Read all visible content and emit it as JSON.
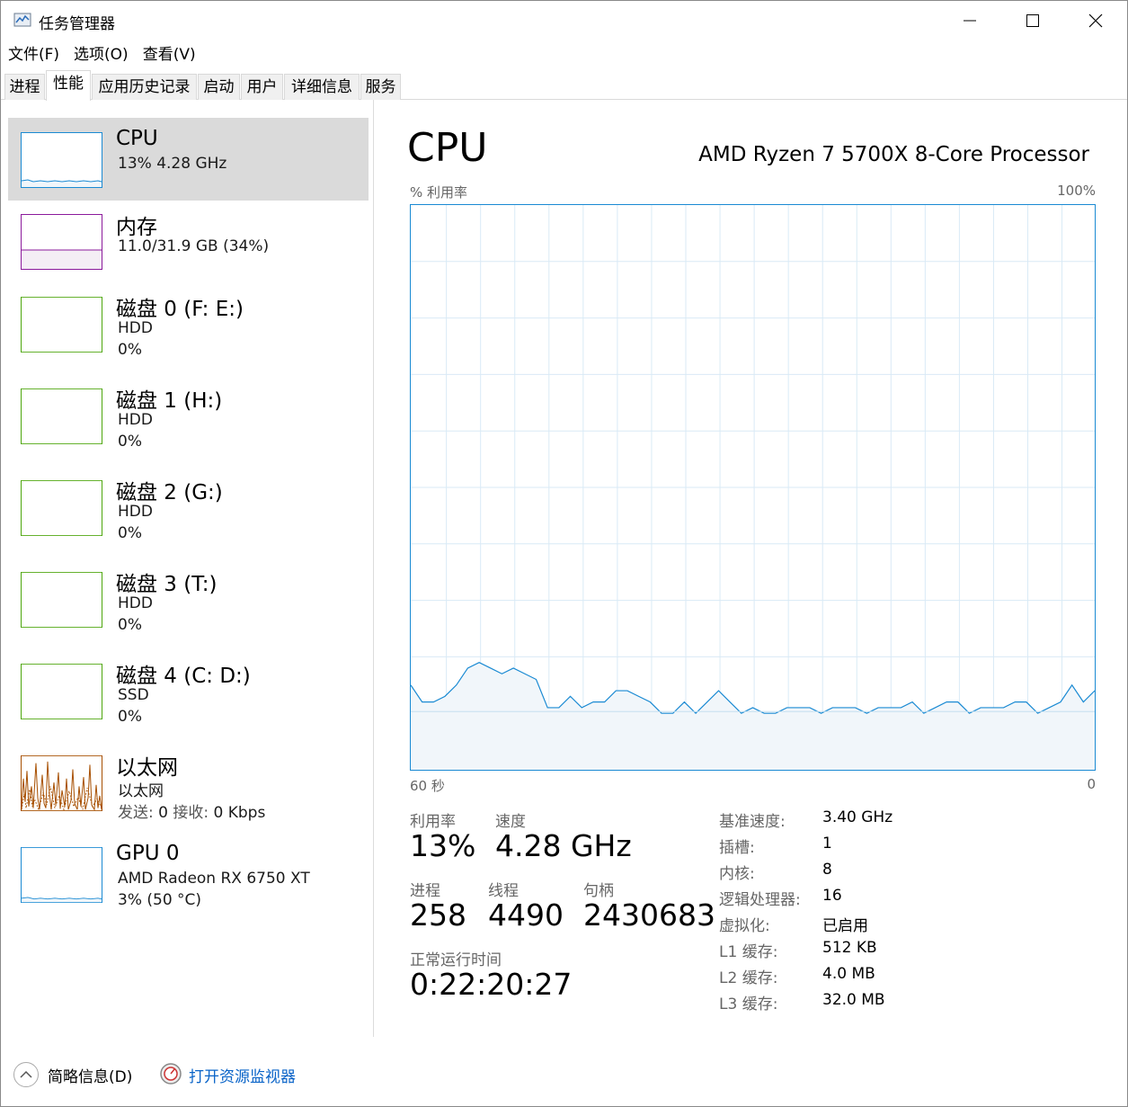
{
  "window": {
    "title": "任务管理器"
  },
  "menu": [
    "文件(F)",
    "选项(O)",
    "查看(V)"
  ],
  "tabs": [
    {
      "label": "进程"
    },
    {
      "label": "性能"
    },
    {
      "label": "应用历史记录"
    },
    {
      "label": "启动"
    },
    {
      "label": "用户"
    },
    {
      "label": "详细信息"
    },
    {
      "label": "服务"
    }
  ],
  "active_tab": "性能",
  "sidebar": {
    "items": [
      {
        "title": "CPU",
        "line1": "13%  4.28 GHz",
        "line2": ""
      },
      {
        "title": "内存",
        "line1": "11.0/31.9 GB (34%)",
        "line2": ""
      },
      {
        "title": "磁盘 0 (F: E:)",
        "line1": "HDD",
        "line2": "0%"
      },
      {
        "title": "磁盘 1 (H:)",
        "line1": "HDD",
        "line2": "0%"
      },
      {
        "title": "磁盘 2 (G:)",
        "line1": "HDD",
        "line2": "0%"
      },
      {
        "title": "磁盘 3 (T:)",
        "line1": "HDD",
        "line2": "0%"
      },
      {
        "title": "磁盘 4 (C: D:)",
        "line1": "SSD",
        "line2": "0%"
      },
      {
        "title": "以太网",
        "line1": "以太网",
        "line2_send_label": "发送:",
        "line2_send": "0",
        "line2_recv_label": "接收:",
        "line2_recv": "0 Kbps"
      },
      {
        "title": "GPU 0",
        "line1": "AMD Radeon RX 6750 XT",
        "line2": "3% (50 °C)"
      }
    ]
  },
  "main": {
    "title": "CPU",
    "processor": "AMD Ryzen 7 5700X 8-Core Processor",
    "util_label": "% 利用率",
    "max_label": "100%",
    "time_left": "60 秒",
    "time_right": "0",
    "stats": {
      "util_label": "利用率",
      "util_value": "13%",
      "speed_label": "速度",
      "speed_value": "4.28 GHz",
      "proc_label": "进程",
      "proc_value": "258",
      "thread_label": "线程",
      "thread_value": "4490",
      "handle_label": "句柄",
      "handle_value": "2430683",
      "uptime_label": "正常运行时间",
      "uptime_value": "0:22:20:27"
    },
    "specs": [
      {
        "label": "基准速度:",
        "value": "3.40 GHz"
      },
      {
        "label": "插槽:",
        "value": "1"
      },
      {
        "label": "内核:",
        "value": "8"
      },
      {
        "label": "逻辑处理器:",
        "value": "16"
      },
      {
        "label": "虚拟化:",
        "value": "已启用"
      },
      {
        "label": "L1 缓存:",
        "value": "512 KB"
      },
      {
        "label": "L2 缓存:",
        "value": "4.0 MB"
      },
      {
        "label": "L3 缓存:",
        "value": "32.0 MB"
      }
    ]
  },
  "footer": {
    "fewer_details": "简略信息(D)",
    "resource_monitor": "打开资源监视器"
  },
  "colors": {
    "cpu": "#1a8ad3",
    "memory": "#8b1a9b",
    "disk": "#4da60c",
    "ethernet": "#a74f01",
    "accent": "#0a64c8"
  },
  "chart_data": {
    "type": "area",
    "ylabel": "% 利用率",
    "ylim": [
      0,
      100
    ],
    "xlim": [
      60,
      0
    ],
    "grid": true,
    "values": [
      15,
      12,
      12,
      13,
      15,
      18,
      19,
      18,
      17,
      18,
      17,
      16,
      11,
      11,
      13,
      11,
      12,
      12,
      14,
      14,
      13,
      12,
      10,
      10,
      12,
      10,
      12,
      14,
      12,
      10,
      11,
      10,
      10,
      11,
      11,
      11,
      10,
      11,
      11,
      11,
      10,
      11,
      11,
      11,
      12,
      10,
      11,
      12,
      12,
      10,
      11,
      11,
      11,
      12,
      12,
      10,
      11,
      12,
      15,
      12,
      14
    ],
    "icons": {
      "app": "task-manager-icon",
      "min": "minimize-icon",
      "max": "maximize-icon",
      "close": "close-icon",
      "fewer": "chevron-up-icon",
      "rm": "resource-monitor-icon"
    }
  }
}
